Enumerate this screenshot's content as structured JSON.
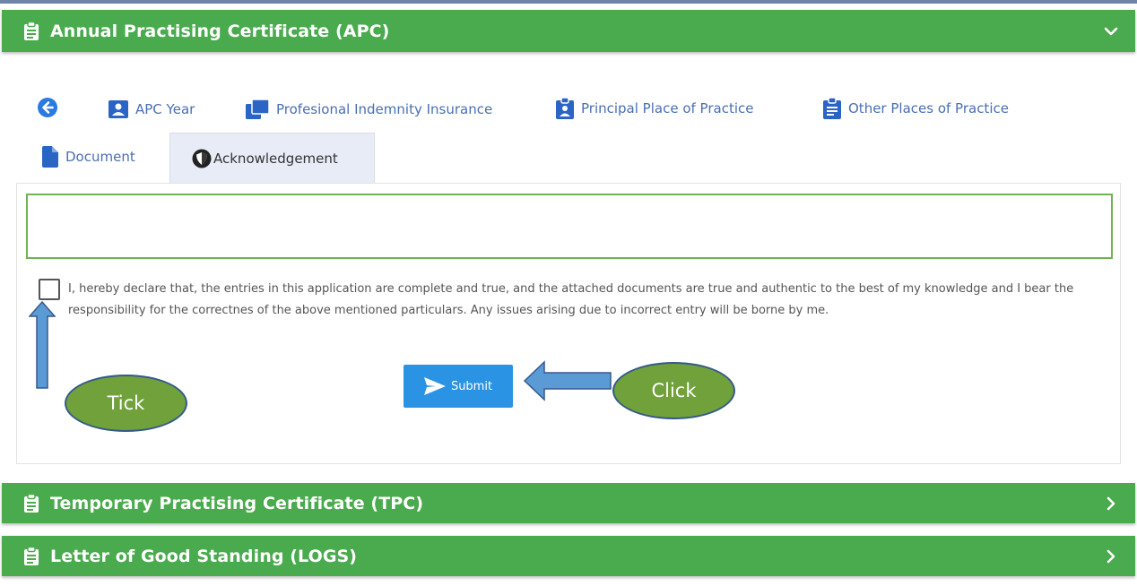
{
  "panels": {
    "apc": {
      "title": "Annual Practising Certificate (APC)",
      "state": "expanded"
    },
    "tpc": {
      "title": "Temporary Practising Certificate (TPC)",
      "state": "collapsed"
    },
    "logs": {
      "title": "Letter of Good Standing (LOGS)",
      "state": "collapsed"
    }
  },
  "tabs": [
    {
      "label": "APC Year",
      "icon": "id-badge-icon"
    },
    {
      "label": "Profesional Indemnity Insurance",
      "icon": "clone-icon"
    },
    {
      "label": "Principal Place of Practice",
      "icon": "clipboard-user-icon"
    },
    {
      "label": "Other Places of Practice",
      "icon": "clipboard-list-icon"
    },
    {
      "label": "Document",
      "icon": "file-icon"
    },
    {
      "label": "Acknowledgement",
      "icon": "shield-icon",
      "active": true
    }
  ],
  "declaration": {
    "text": "I, hereby declare that, the entries in this application are complete and true, and the attached documents are true and authentic to the best of my knowledge and I bear the responsibility for the correctnes of the above mentioned particulars. Any issues arising due to incorrect entry will be borne by me.",
    "checked": false
  },
  "submit_label": "Submit",
  "annotations": {
    "tick_label": "Tick",
    "click_label": "Click"
  },
  "colors": {
    "header_green": "#4aaa4e",
    "tab_blue": "#4a6fb2",
    "submit_blue": "#2a93e3",
    "annotation_green": "#70a13b",
    "annotation_arrow": "#5b9bd5"
  }
}
